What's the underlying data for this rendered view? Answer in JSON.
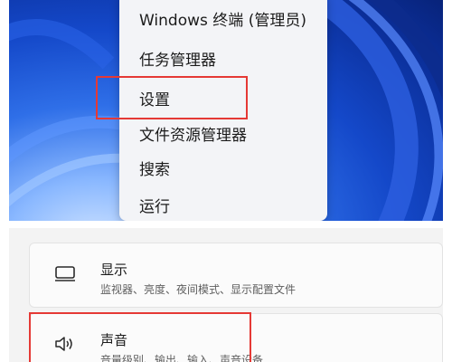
{
  "context_menu": {
    "items": [
      {
        "label": "Windows 终端 (管理员)"
      },
      {
        "label": "任务管理器"
      },
      {
        "label": "设置"
      },
      {
        "label": "文件资源管理器"
      },
      {
        "label": "搜索"
      },
      {
        "label": "运行"
      }
    ],
    "highlighted_item": "设置"
  },
  "settings": {
    "items": [
      {
        "title": "显示",
        "subtitle": "监视器、亮度、夜间模式、显示配置文件",
        "icon": "monitor-icon"
      },
      {
        "title": "声音",
        "subtitle": "音量级别、输出、输入、声音设备",
        "icon": "speaker-icon"
      }
    ],
    "highlighted_item": "声音"
  },
  "colors": {
    "highlight": "#e53935",
    "desktop_blue": "#1448c9",
    "menu_bg": "#f3f4f7",
    "card_bg": "#fbfbfb"
  }
}
